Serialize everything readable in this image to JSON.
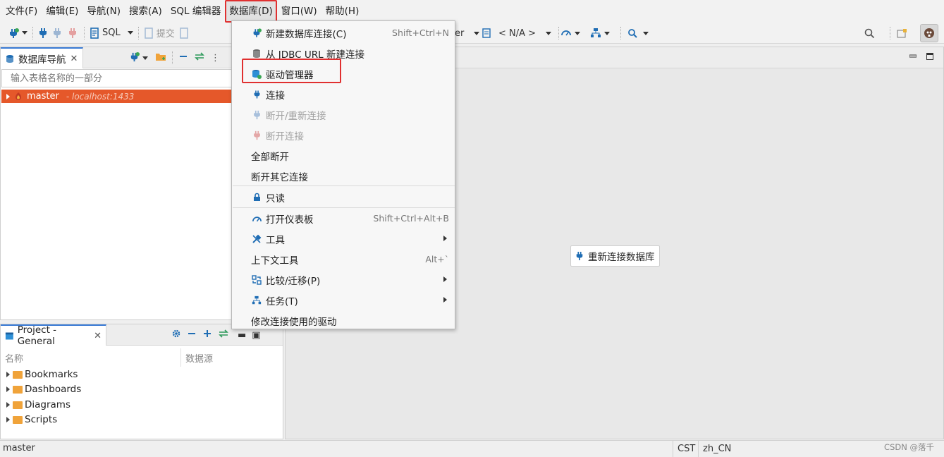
{
  "menubar": {
    "items": [
      "文件(F)",
      "编辑(E)",
      "导航(N)",
      "搜索(A)",
      "SQL 编辑器",
      "数据库(D)",
      "窗口(W)",
      "帮助(H)"
    ],
    "active_index": 5
  },
  "toolbar": {
    "sql_label": "SQL",
    "commit_label": "提交",
    "schema_fragment": "er",
    "na_label": "< N/A >"
  },
  "navigator": {
    "tab_label": "数据库导航",
    "filter_placeholder": "输入表格名称的一部分",
    "tree": [
      {
        "name": "master",
        "sub": " - localhost:1433",
        "selected": true
      }
    ]
  },
  "project": {
    "tab_label": "Project - General",
    "columns": [
      "名称",
      "数据源"
    ],
    "items": [
      "Bookmarks",
      "Dashboards",
      "Diagrams",
      "Scripts"
    ]
  },
  "editor": {
    "reconnect_label": "重新连接数据库"
  },
  "database_menu": {
    "highlight_color": "#e03030",
    "items": [
      {
        "label": "新建数据库连接(C)",
        "shortcut": "Shift+Ctrl+N",
        "icon": "new-connection-icon"
      },
      {
        "label": "从 JDBC URL 新建连接",
        "icon": "database-icon"
      },
      {
        "label": "驱动管理器",
        "icon": "driver-manager-icon",
        "highlighted": true
      },
      {
        "label": "连接",
        "icon": "plug-icon"
      },
      {
        "label": "断开/重新连接",
        "icon": "reconnect-icon",
        "disabled": true
      },
      {
        "label": "断开连接",
        "icon": "disconnect-icon",
        "disabled": true
      },
      {
        "label": "全部断开"
      },
      {
        "label": "断开其它连接"
      },
      {
        "label": "只读",
        "icon": "lock-icon"
      },
      {
        "label": "打开仪表板",
        "shortcut": "Shift+Ctrl+Alt+B",
        "icon": "dashboard-icon"
      },
      {
        "label": "工具",
        "icon": "tools-icon",
        "submenu": true
      },
      {
        "label": "上下文工具",
        "shortcut": "Alt+`"
      },
      {
        "label": "比较/迁移(P)",
        "icon": "compare-icon",
        "submenu": true
      },
      {
        "label": "任务(T)",
        "icon": "tasks-icon",
        "submenu": true
      },
      {
        "label": "修改连接使用的驱动"
      }
    ]
  },
  "statusbar": {
    "left": "master",
    "timezone": "CST",
    "locale": "zh_CN"
  },
  "watermark": "CSDN @落千"
}
